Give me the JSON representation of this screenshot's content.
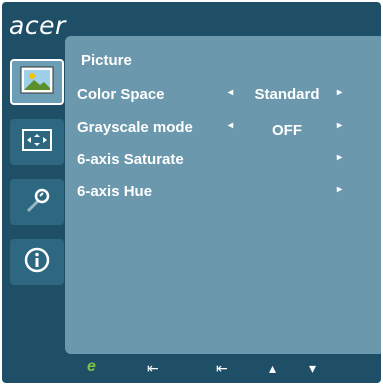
{
  "brand": {
    "name": "acer"
  },
  "sidebar": {
    "items": [
      {
        "name": "picture",
        "icon": "image-icon",
        "active": true
      },
      {
        "name": "display",
        "icon": "screen-resize-icon",
        "active": false
      },
      {
        "name": "settings",
        "icon": "wrench-settings-icon",
        "active": false
      },
      {
        "name": "information",
        "icon": "info-icon",
        "active": false
      }
    ]
  },
  "panel": {
    "title": "Picture",
    "rows": [
      {
        "label": "Color Space",
        "value": "Standard",
        "left_arrow": "◂",
        "right_arrow": "▸"
      },
      {
        "label": "Grayscale mode",
        "value": "OFF",
        "left_arrow": "◂",
        "right_arrow": "▸"
      },
      {
        "label": "6-axis Saturate",
        "value": "",
        "left_arrow": "",
        "right_arrow": "▸"
      },
      {
        "label": "6-axis Hue",
        "value": "",
        "left_arrow": "",
        "right_arrow": "▸"
      }
    ]
  },
  "footer": {
    "buttons": [
      {
        "name": "empowering",
        "icon": "e-logo-icon",
        "glyph": "e"
      },
      {
        "name": "exit-1",
        "icon": "enter-exit-icon",
        "glyph": "⇤"
      },
      {
        "name": "exit-2",
        "icon": "enter-exit-icon",
        "glyph": "⇤"
      },
      {
        "name": "up",
        "icon": "arrow-up-icon",
        "glyph": "▴"
      },
      {
        "name": "down",
        "icon": "arrow-down-icon",
        "glyph": "▾"
      }
    ]
  },
  "colors": {
    "frame": "#1f4f66",
    "panel": "#6b98ad",
    "active_tab": "#6c9fb6",
    "tab": "#2e6780",
    "accent_green": "#7dc242"
  }
}
